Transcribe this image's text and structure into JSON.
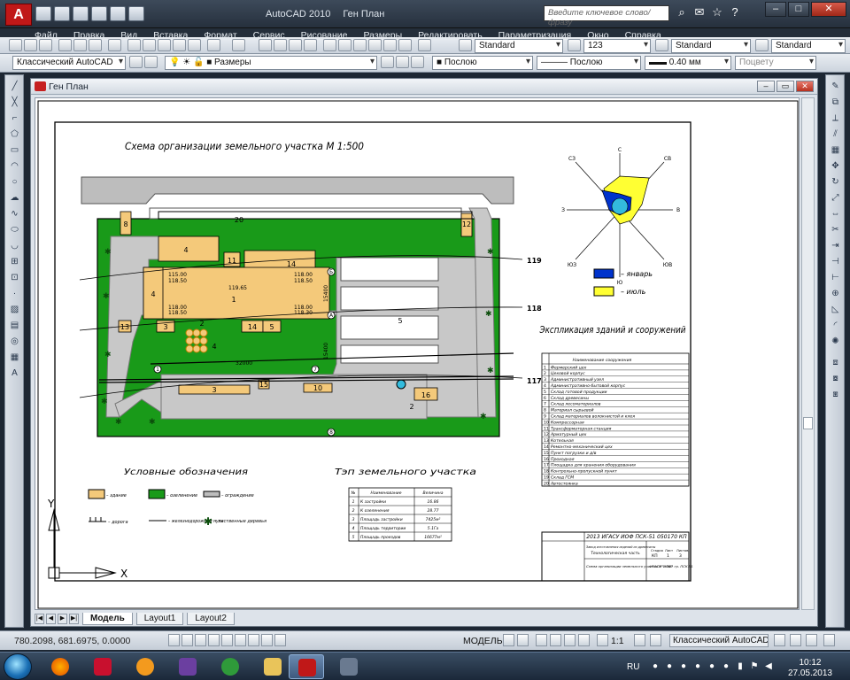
{
  "app": {
    "logo_letter": "A",
    "name": "AutoCAD 2010",
    "doc_name": "Ген План",
    "help_search_placeholder": "Введите ключевое слово/фразу"
  },
  "menu": [
    "Файл",
    "Правка",
    "Вид",
    "Вставка",
    "Формат",
    "Сервис",
    "Рисование",
    "Размеры",
    "Редактировать",
    "Параметризация",
    "Окно",
    "Справка"
  ],
  "toolbar1": {
    "text_style": "Standard",
    "dim_value": "123",
    "dim_style": "Standard",
    "table_style": "Standard"
  },
  "toolbar2": {
    "workspace": "Классический AutoCAD",
    "layer": "Размеры",
    "color": "Послою",
    "linetype": "Послою",
    "lineweight": "0.40 мм",
    "plotstyle": "Поцвету"
  },
  "drawing": {
    "main_title": "Схема организации земельного участка М 1:500",
    "wind_rose": {
      "labels": {
        "north": "С",
        "northeast": "СВ",
        "east": "В",
        "southeast": "ЮВ",
        "south": "Ю",
        "southwest": "ЮЗ",
        "west": "З",
        "northwest": "СЗ"
      },
      "legend": [
        {
          "label": "– январь",
          "color": "#0033cc"
        },
        {
          "label": "– июль",
          "color": "#ffff33"
        }
      ]
    },
    "contours": [
      "119",
      "118",
      "117"
    ],
    "buildings": [
      {
        "id": "4"
      },
      {
        "id": "11"
      },
      {
        "id": "14"
      },
      {
        "id": "1"
      },
      {
        "id": "3"
      },
      {
        "id": "13"
      },
      {
        "id": "14"
      },
      {
        "id": "5"
      },
      {
        "id": "2"
      },
      {
        "id": "16"
      },
      {
        "id": "15"
      },
      {
        "id": "10"
      },
      {
        "id": "8"
      },
      {
        "id": "20"
      },
      {
        "id": "12"
      },
      {
        "id": "5"
      },
      {
        "id": "4"
      },
      {
        "id": "2"
      },
      {
        "id": "3"
      }
    ],
    "elevations": [
      "115.00",
      "118.50",
      "119.65",
      "118.00",
      "118.50",
      "118.00",
      "118.50",
      "118.00",
      "118.30",
      "1"
    ],
    "dimensions": [
      "15400",
      "32000",
      "15400"
    ],
    "axes": [
      "A",
      "B",
      "Б",
      "А",
      "1",
      "7",
      "8"
    ],
    "ucs": {
      "y": "Y",
      "x": "X"
    },
    "legend_title": "Условные обозначения",
    "legend_items": [
      {
        "label": "– здание",
        "kind": "building"
      },
      {
        "label": "– озеленение",
        "kind": "green"
      },
      {
        "label": "– ограждение",
        "kind": "fence"
      },
      {
        "label": "– дорога",
        "kind": "road"
      },
      {
        "label": "– железнодорожный путь",
        "kind": "rail"
      },
      {
        "label": "– лиственные деревья",
        "kind": "tree"
      }
    ],
    "tep_title": "Тэп земельного участка",
    "tep_headers": [
      "№",
      "Наименование",
      "Величина"
    ],
    "tep_rows": [
      [
        "1",
        "К застройки",
        "16.86"
      ],
      [
        "2",
        "К озеленения",
        "28.77"
      ],
      [
        "3",
        "Площадь застройки",
        "7425м²"
      ],
      [
        "4",
        "Площадь территории",
        "5.1Га"
      ],
      [
        "5",
        "Площадь проездов",
        "16677м²"
      ]
    ],
    "explication_title": "Экспликация зданий и сооружений",
    "explication_header": "Наименование сооружения",
    "explication": [
      "Фермерский цех",
      "Цеховой корпус",
      "Административный узел",
      "Административно-бытовой корпус",
      "Склад готовой продукции",
      "Склад древесины",
      "Склад лесоматериалов",
      "Материал сырьевой",
      "Склад материалов волокнистой и клея",
      "Компрессорная",
      "Трансформаторная станция",
      "Арматурный цех",
      "Котельная",
      "Ремонтно-механический цех",
      "Пункт погрузки и д/в",
      "Проходная",
      "Площадка для хранения оборудования",
      "Контрольно-пропускной пункт",
      "Склад ГСМ",
      "Автостоянка"
    ],
    "stamp": {
      "code": "2013 ИГАСУ ИОФ ПСК-51 050170 КП",
      "subject": "Завод изготовления изделий из древесины",
      "section": "Технологическая часть",
      "stage_headers": [
        "Стадия",
        "Лист",
        "Листов"
      ],
      "stage_values": [
        "КП",
        "1",
        "3"
      ],
      "sheet_title": "Схема организации земельного участка М 1:500",
      "org": "ИГАСУ \"ИОФ\" гр. ПСК-51"
    }
  },
  "tabs": [
    "Модель",
    "Layout1",
    "Layout2"
  ],
  "status": {
    "coords": "780.2098, 681.6975, 0.0000",
    "model": "МОДЕЛЬ",
    "scale": "1:1",
    "workspace": "Классический AutoCAD"
  },
  "taskbar": {
    "lang": "RU",
    "time": "10:12",
    "date": "27.05.2013"
  }
}
